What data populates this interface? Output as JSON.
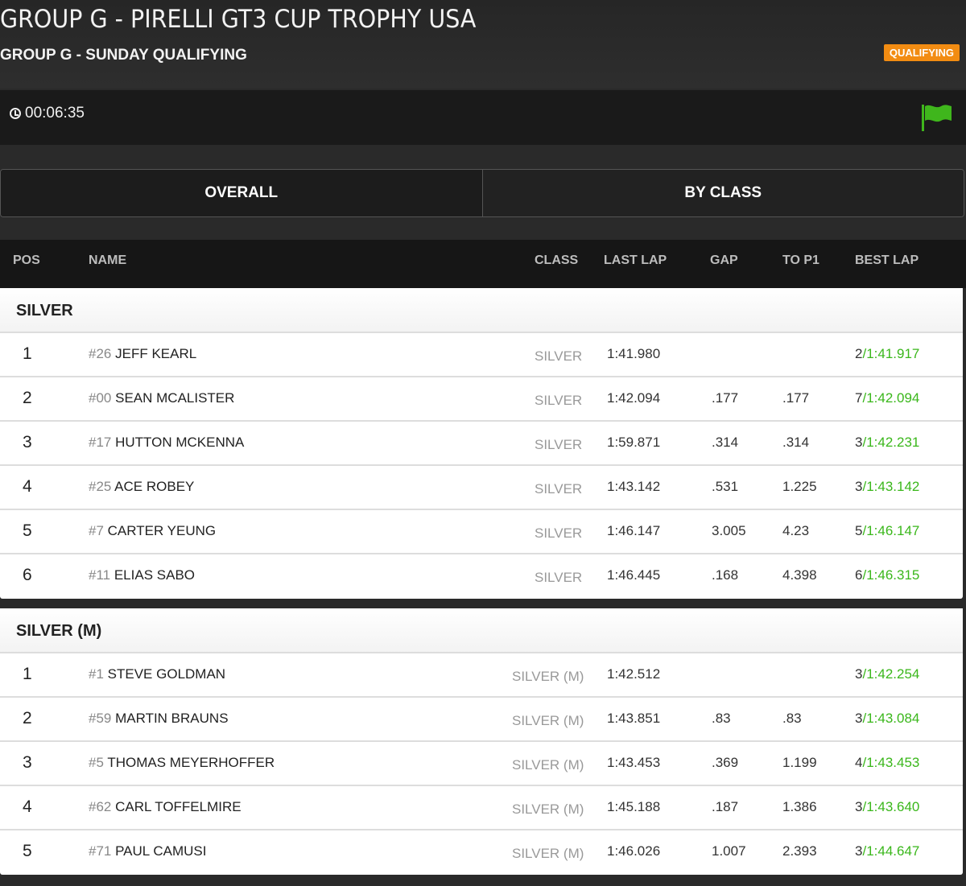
{
  "header": {
    "title": "GROUP G - PIRELLI GT3 CUP TROPHY USA",
    "subtitle": "GROUP G - SUNDAY QUALIFYING",
    "badge": "QUALIFYING"
  },
  "timer": {
    "value": "00:06:35",
    "icon": "clock-icon",
    "flag_icon": "green-flag-icon"
  },
  "tabs": [
    {
      "label": "OVERALL"
    },
    {
      "label": "BY CLASS"
    }
  ],
  "columns": {
    "pos": "POS",
    "name": "NAME",
    "class": "CLASS",
    "last_lap": "LAST LAP",
    "gap": "GAP",
    "to_p1": "TO P1",
    "best_lap": "BEST LAP"
  },
  "colors": {
    "accent_orange": "#f28c12",
    "best_green": "#3ab71b",
    "flag_green": "#3fb61c"
  },
  "groups": [
    {
      "name": "SILVER",
      "rows": [
        {
          "pos": "1",
          "num": "#26",
          "driver": "JEFF KEARL",
          "class": "SILVER",
          "last_lap": "1:41.980",
          "gap": "",
          "to_p1": "",
          "best_laps": "2",
          "best_time": "1:41.917"
        },
        {
          "pos": "2",
          "num": "#00",
          "driver": "SEAN MCALISTER",
          "class": "SILVER",
          "last_lap": "1:42.094",
          "gap": ".177",
          "to_p1": ".177",
          "best_laps": "7",
          "best_time": "1:42.094"
        },
        {
          "pos": "3",
          "num": "#17",
          "driver": "HUTTON MCKENNA",
          "class": "SILVER",
          "last_lap": "1:59.871",
          "gap": ".314",
          "to_p1": ".314",
          "best_laps": "3",
          "best_time": "1:42.231"
        },
        {
          "pos": "4",
          "num": "#25",
          "driver": "ACE ROBEY",
          "class": "SILVER",
          "last_lap": "1:43.142",
          "gap": ".531",
          "to_p1": "1.225",
          "best_laps": "3",
          "best_time": "1:43.142"
        },
        {
          "pos": "5",
          "num": "#7",
          "driver": "CARTER YEUNG",
          "class": "SILVER",
          "last_lap": "1:46.147",
          "gap": "3.005",
          "to_p1": "4.23",
          "best_laps": "5",
          "best_time": "1:46.147"
        },
        {
          "pos": "6",
          "num": "#11",
          "driver": "ELIAS SABO",
          "class": "SILVER",
          "last_lap": "1:46.445",
          "gap": ".168",
          "to_p1": "4.398",
          "best_laps": "6",
          "best_time": "1:46.315"
        }
      ]
    },
    {
      "name": "SILVER (M)",
      "rows": [
        {
          "pos": "1",
          "num": "#1",
          "driver": "STEVE GOLDMAN",
          "class": "SILVER (M)",
          "last_lap": "1:42.512",
          "gap": "",
          "to_p1": "",
          "best_laps": "3",
          "best_time": "1:42.254"
        },
        {
          "pos": "2",
          "num": "#59",
          "driver": "MARTIN BRAUNS",
          "class": "SILVER (M)",
          "last_lap": "1:43.851",
          "gap": ".83",
          "to_p1": ".83",
          "best_laps": "3",
          "best_time": "1:43.084"
        },
        {
          "pos": "3",
          "num": "#5",
          "driver": "THOMAS MEYERHOFFER",
          "class": "SILVER (M)",
          "last_lap": "1:43.453",
          "gap": ".369",
          "to_p1": "1.199",
          "best_laps": "4",
          "best_time": "1:43.453"
        },
        {
          "pos": "4",
          "num": "#62",
          "driver": "CARL TOFFELMIRE",
          "class": "SILVER (M)",
          "last_lap": "1:45.188",
          "gap": ".187",
          "to_p1": "1.386",
          "best_laps": "3",
          "best_time": "1:43.640"
        },
        {
          "pos": "5",
          "num": "#71",
          "driver": "PAUL CAMUSI",
          "class": "SILVER (M)",
          "last_lap": "1:46.026",
          "gap": "1.007",
          "to_p1": "2.393",
          "best_laps": "3",
          "best_time": "1:44.647"
        }
      ]
    }
  ]
}
